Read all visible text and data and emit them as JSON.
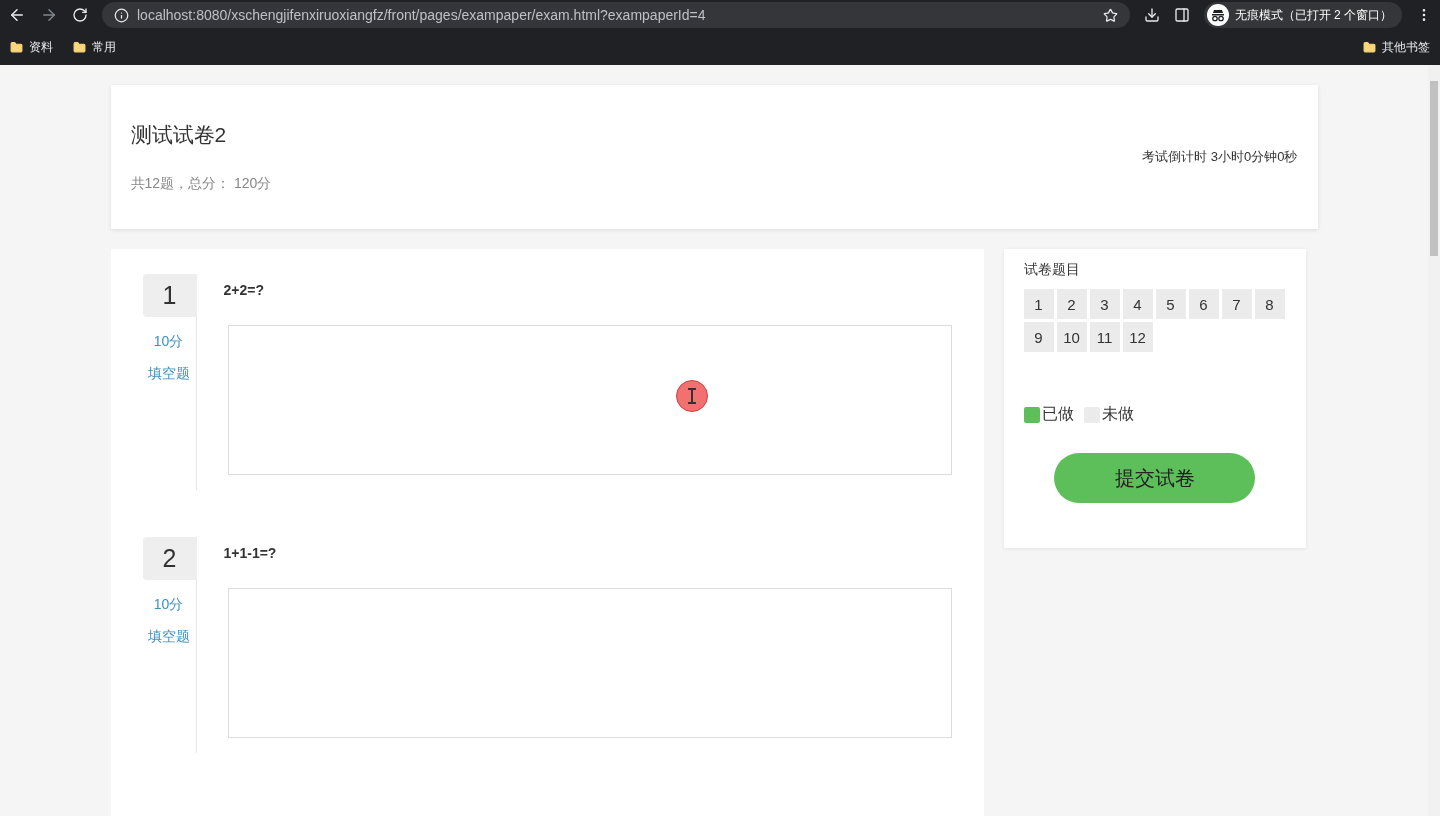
{
  "browser": {
    "url": "localhost:8080/xschengjifenxiruoxiangfz/front/pages/exampaper/exam.html?exampaperId=4",
    "incognito_label": "无痕模式（已打开 2 个窗口）",
    "bookmarks": [
      "资料",
      "常用"
    ],
    "other_bookmarks": "其他书签"
  },
  "exam": {
    "title": "测试试卷2",
    "summary": "共12题，总分： 120分",
    "countdown": "考试倒计时 3小时0分钟0秒"
  },
  "questions": [
    {
      "number": "1",
      "score": "10分",
      "type": "填空题",
      "title": "2+2=?"
    },
    {
      "number": "2",
      "score": "10分",
      "type": "填空题",
      "title": "1+1-1=?"
    }
  ],
  "navigator": {
    "title": "试卷题目",
    "items": [
      {
        "label": "1",
        "done": false
      },
      {
        "label": "2",
        "done": false
      },
      {
        "label": "3",
        "done": false
      },
      {
        "label": "4",
        "done": false
      },
      {
        "label": "5",
        "done": false
      },
      {
        "label": "6",
        "done": false
      },
      {
        "label": "7",
        "done": false
      },
      {
        "label": "8",
        "done": false
      },
      {
        "label": "9",
        "done": false
      },
      {
        "label": "10",
        "done": false
      },
      {
        "label": "11",
        "done": false
      },
      {
        "label": "12",
        "done": false
      }
    ],
    "legend": [
      {
        "label": "已做",
        "kind": "done"
      },
      {
        "label": "未做",
        "kind": "undone"
      }
    ],
    "submit": "提交试卷"
  }
}
